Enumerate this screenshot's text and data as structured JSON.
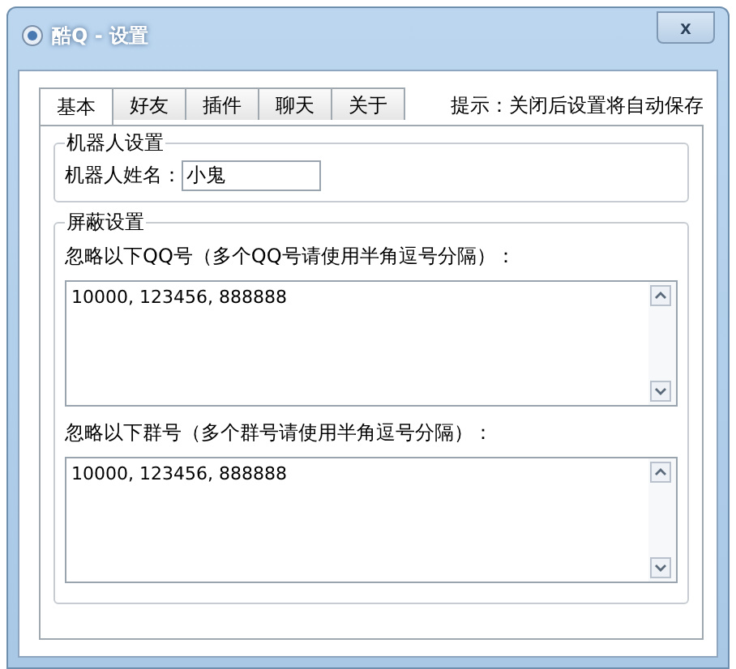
{
  "window": {
    "title": "酷Q - 设置",
    "close": "x"
  },
  "tabs": [
    {
      "label": "基本",
      "selected": true
    },
    {
      "label": "好友",
      "selected": false
    },
    {
      "label": "插件",
      "selected": false
    },
    {
      "label": "聊天",
      "selected": false
    },
    {
      "label": "关于",
      "selected": false
    }
  ],
  "hint": "提示：关闭后设置将自动保存",
  "robot_group": {
    "title": "机器人设置",
    "name_label": "机器人姓名：",
    "name_value": "小鬼"
  },
  "block_group": {
    "title": "屏蔽设置",
    "fields": [
      {
        "label": "忽略以下QQ号（多个QQ号请使用半角逗号分隔）：",
        "value": "10000, 123456, 888888"
      },
      {
        "label": "忽略以下群号（多个群号请使用半角逗号分隔）：",
        "value": "10000, 123456, 888888"
      }
    ]
  }
}
